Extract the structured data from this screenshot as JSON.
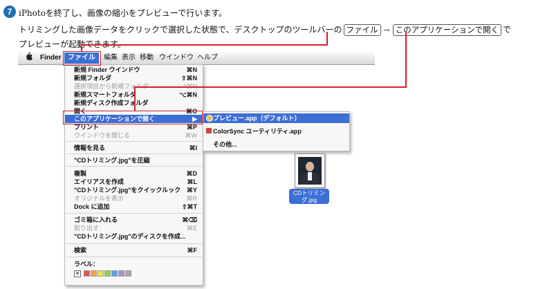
{
  "instruction": {
    "step_number": "7",
    "line1": "iPhotoを終了し、画像の縮小をプレビューで行います。",
    "line2_prefix": "トリミングした画像データをクリックで選択した状態で、デスクトップのツールバーの",
    "line2_box1": "ファイル",
    "line2_arrow": "→",
    "line2_box2": "このアプリケーションで開く",
    "line2_suffix": "で",
    "line3": "プレビューが起動できます。"
  },
  "menubar": {
    "apple": "",
    "items": [
      "Finder",
      "ファイル",
      "編集",
      "表示",
      "移動",
      "ウインドウ",
      "ヘルプ"
    ]
  },
  "file_menu": {
    "items": [
      {
        "label": "新規 Finder ウインドウ",
        "shortcut": "⌘N"
      },
      {
        "label": "新規フォルダ",
        "shortcut": "⇧⌘N"
      },
      {
        "label": "選択項目から新規フォルダ",
        "shortcut": "^⌘N"
      },
      {
        "label": "新規スマートフォルダ",
        "shortcut": "⌥⌘N"
      },
      {
        "label": "新規ディスク作成フォルダ",
        "shortcut": ""
      },
      {
        "label": "開く",
        "shortcut": "⌘O"
      },
      {
        "label": "このアプリケーションで開く",
        "shortcut": "▶"
      },
      {
        "label": "プリント",
        "shortcut": "⌘P"
      },
      {
        "label": "ウインドウを閉じる",
        "shortcut": "⌘W"
      },
      {
        "label": "情報を見る",
        "shortcut": "⌘I"
      },
      {
        "label": "\"CDトリミング.jpg\"を圧縮",
        "shortcut": ""
      },
      {
        "label": "複製",
        "shortcut": "⌘D"
      },
      {
        "label": "エイリアスを作成",
        "shortcut": "⌘L"
      },
      {
        "label": "\"CDトリミング.jpg\"をクイックルック",
        "shortcut": "⌘Y"
      },
      {
        "label": "オリジナルを表示",
        "shortcut": "⌘R"
      },
      {
        "label": "Dock に追加",
        "shortcut": "⇧⌘T"
      },
      {
        "label": "ゴミ箱に入れる",
        "shortcut": "⌘⌫"
      },
      {
        "label": "取り出す",
        "shortcut": "⌘E"
      },
      {
        "label": "\"CDトリミング.jpg\"のディスクを作成...",
        "shortcut": ""
      },
      {
        "label": "検索",
        "shortcut": "⌘F"
      },
      {
        "label": "ラベル：",
        "shortcut": ""
      }
    ],
    "label_colors": [
      "#e8534b",
      "#f4a53c",
      "#f2e04a",
      "#8fd14f",
      "#5aa7e8",
      "#b28ad8",
      "#a8a8a8"
    ],
    "label_none": "✕"
  },
  "submenu": {
    "items": [
      {
        "label": "プレビュー.app（デフォルト）"
      },
      {
        "label": "ColorSync ユーティリティ.app"
      },
      {
        "label": "その他..."
      }
    ]
  },
  "desktop_file": {
    "name": "CDトリミン\nグ.jpg"
  },
  "colors": {
    "highlight": "#3d6ed6",
    "callout": "#d41f2a",
    "step_badge": "#1f6fb2"
  }
}
